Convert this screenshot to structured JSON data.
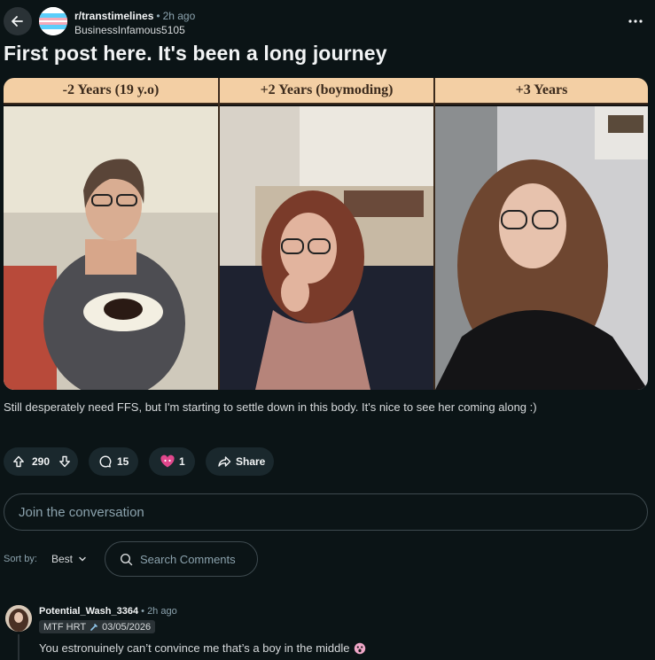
{
  "post": {
    "subreddit": "r/transtimelines",
    "time": "2h ago",
    "author": "BusinessInfamous5105",
    "title": "First post here. It's been a long journey",
    "caption": "Still desperately need FFS, but I'm starting to settle down in this body. It's nice to see her coming along :)"
  },
  "image": {
    "panels": [
      {
        "label": "-2 Years (19 y.o)"
      },
      {
        "label": "+2 Years (boymoding)"
      },
      {
        "label": "+3 Years"
      }
    ]
  },
  "actions": {
    "votes": "290",
    "comments": "15",
    "awards": "1",
    "share": "Share"
  },
  "join": {
    "placeholder": "Join the conversation"
  },
  "sort": {
    "label": "Sort by:",
    "value": "Best"
  },
  "search": {
    "placeholder": "Search Comments"
  },
  "comment": {
    "user": "Potential_Wash_3364",
    "time": "2h ago",
    "flair": "MTF HRT",
    "flair_date": "03/05/2026",
    "body": "You estronuinely can’t convince me that’s a boy in the middle"
  },
  "colors": {
    "background": "#0b1416",
    "pill": "#1a282d",
    "panel_header": "#f3cfa4"
  }
}
